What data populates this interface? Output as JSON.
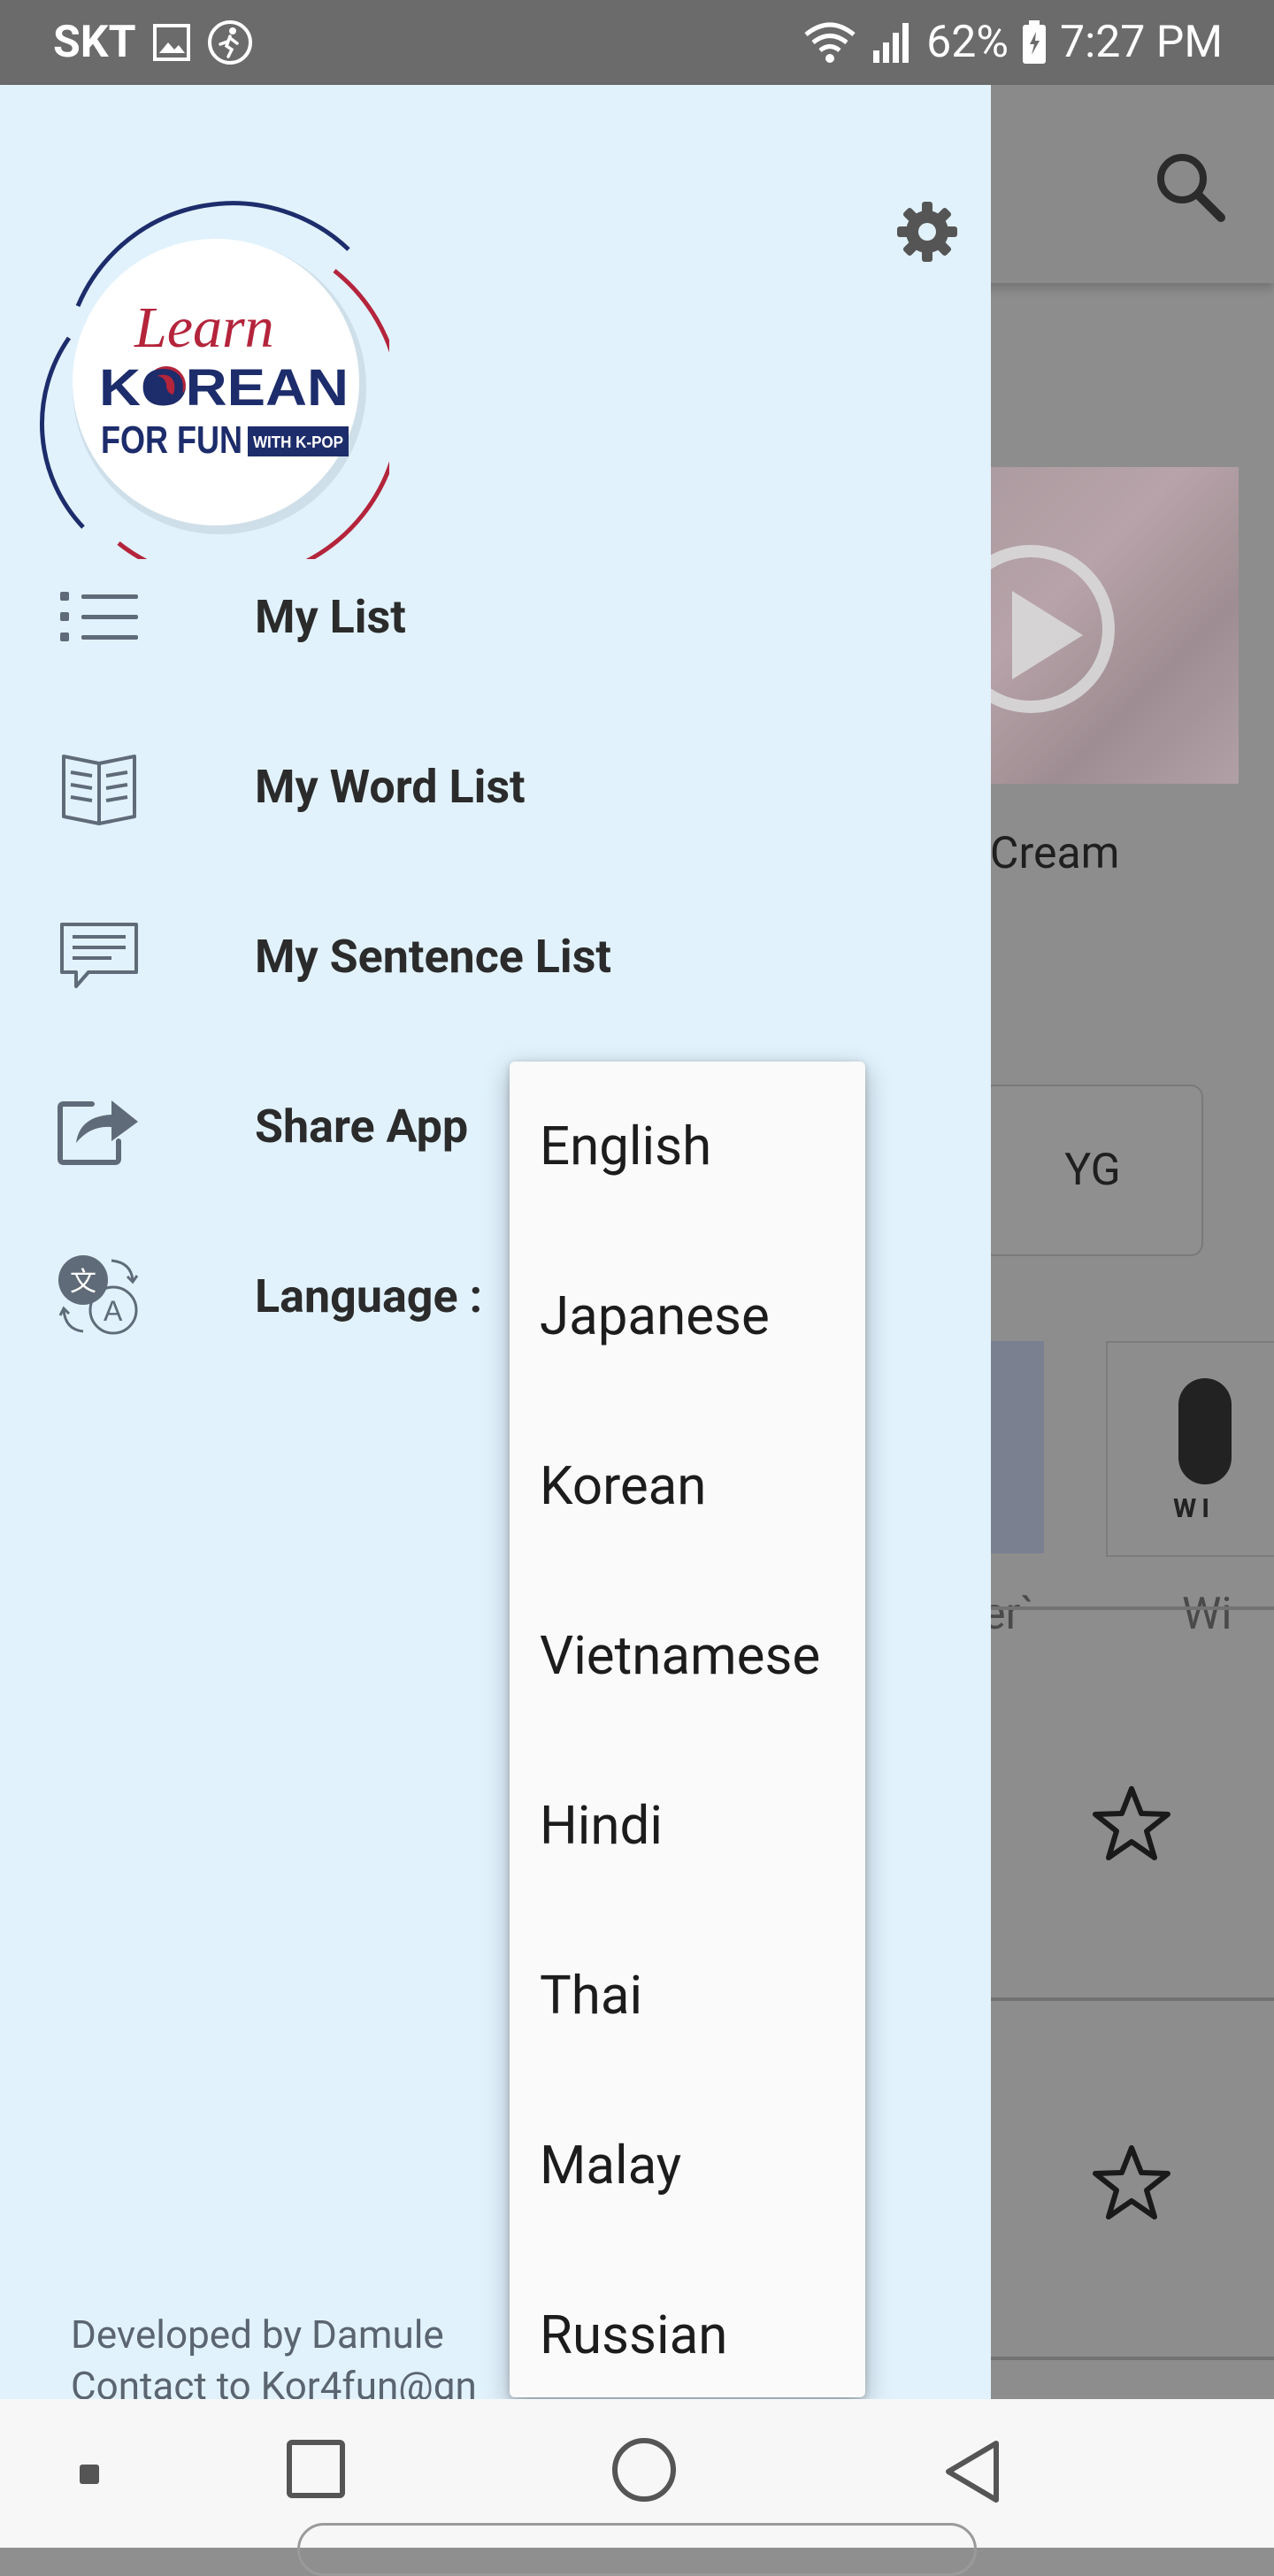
{
  "status_bar": {
    "carrier": "SKT",
    "battery": "62%",
    "time": "7:27 PM",
    "icons": [
      "gallery-icon",
      "activity-icon",
      "wifi-icon",
      "signal-icon",
      "battery-icon"
    ]
  },
  "background_app": {
    "card_caption": "e Cream",
    "chip_label": "YG",
    "thumb_text_1": "er`",
    "thumb_text_2": "Wi",
    "thumb_logo_text": "WI",
    "icons": [
      "search-icon",
      "play-icon",
      "star-icon"
    ]
  },
  "drawer": {
    "logo": {
      "learn": "Learn",
      "korean": "KOREAN",
      "for_fun": "FOR FUN",
      "with_kpop": "WITH K-POP"
    },
    "settings_icon": "gear-icon",
    "menu": [
      {
        "label": "My List",
        "icon": "list-icon"
      },
      {
        "label": "My Word List",
        "icon": "book-icon"
      },
      {
        "label": "My Sentence List",
        "icon": "message-icon"
      },
      {
        "label": "Share App",
        "icon": "share-icon"
      },
      {
        "label": "Language :",
        "icon": "translate-icon"
      }
    ],
    "footer": {
      "developer": "Developed by Damule",
      "contact": "Contact to Kor4fun@gn"
    }
  },
  "language_dropdown": {
    "options": [
      "English",
      "Japanese",
      "Korean",
      "Vietnamese",
      "Hindi",
      "Thai",
      "Malay",
      "Russian"
    ]
  },
  "nav_bar": {
    "icons": [
      "notification-dot-icon",
      "recents-icon",
      "home-icon",
      "back-icon"
    ]
  },
  "colors": {
    "drawer_bg": "#e1f2fd",
    "logo_blue": "#1d2c6b",
    "logo_red": "#b4243b",
    "status_bar": "#6b6b6b"
  }
}
